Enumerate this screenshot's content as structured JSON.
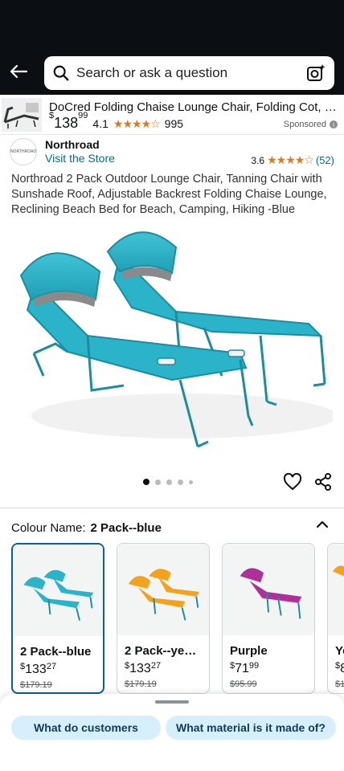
{
  "search": {
    "placeholder": "Search or ask a question"
  },
  "sponsored": {
    "title": "DoCred Folding Chaise Lounge Chair, Folding Cot, 5-Po…",
    "price_symbol": "$",
    "price_whole": "138",
    "price_fraction": "99",
    "rating": "4.1",
    "stars": "★★★★☆",
    "review_count": "995",
    "label": "Sponsored",
    "info_icon": "i"
  },
  "brand": {
    "name": "Northroad",
    "logo_text": "NORTHROAD",
    "visit_store": "Visit the Store",
    "rating": "3.6",
    "stars": "★★★★☆",
    "review_count": "(52)"
  },
  "product": {
    "title": "Northroad 2 Pack Outdoor Lounge Chair, Tanning Chair with Sunshade Roof, Adjustable Backrest Folding Chaise Lounge, Reclining Beach Bed for Beach, Camping, Hiking -Blue",
    "image_count": 5,
    "active_image": 0
  },
  "colour": {
    "label": "Colour Name:",
    "selected": "2 Pack--blue",
    "options": [
      {
        "name": "2 Pack--blue",
        "price_symbol": "$",
        "price_whole": "133",
        "price_fraction": "27",
        "old_price": "$179.19",
        "color": "#2bb3c9"
      },
      {
        "name": "2 Pack--ye…",
        "price_symbol": "$",
        "price_whole": "133",
        "price_fraction": "27",
        "old_price": "$179.19",
        "color": "#f2a21b"
      },
      {
        "name": "Purple",
        "price_symbol": "$",
        "price_whole": "71",
        "price_fraction": "99",
        "old_price": "$95.99",
        "color": "#b0309a"
      },
      {
        "name": "Ye",
        "price_symbol": "$",
        "price_whole": "8",
        "price_fraction": "",
        "old_price": "$1",
        "color": "#f2a21b"
      }
    ]
  },
  "suggestions": [
    {
      "label": "What do customers"
    },
    {
      "label": "What material is it made of?"
    }
  ],
  "colors": {
    "accent": "#007185",
    "star": "#de7921",
    "chip_bg": "#d7eefb",
    "selected_border": "#0b5ea8",
    "chair_blue": "#2bb3c9"
  }
}
